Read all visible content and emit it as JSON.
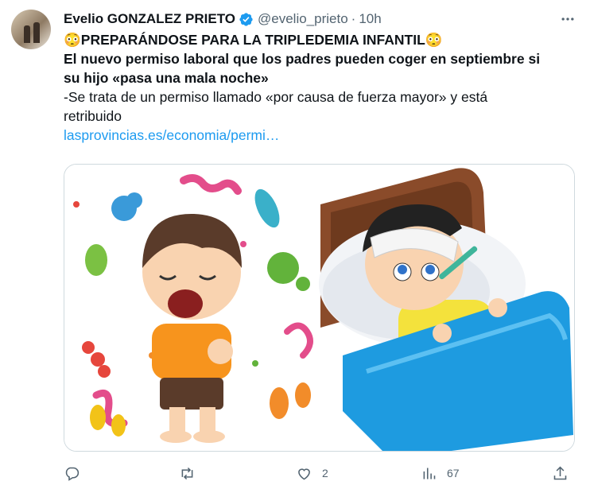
{
  "author": {
    "name": "Evelio GONZALEZ PRIETO",
    "handle": "@evelio_prieto",
    "time": "10h"
  },
  "tweet": {
    "headline": "😳PREPARÁNDOSE PARA LA TRIPLEDEMIA INFANTIL😳",
    "subhead_line1": "El nuevo permiso laboral que los padres pueden coger en septiembre si",
    "subhead_line2": "su hijo «pasa una mala noche»",
    "body_line1": "-Se trata de un permiso llamado «por causa de fuerza mayor» y está",
    "body_line2": "retribuido",
    "link": "lasprovincias.es/economia/permi…"
  },
  "metrics": {
    "replies": "",
    "reposts": "",
    "likes": "2",
    "views": "67"
  },
  "icons": {
    "verified": "verified-badge-icon",
    "more": "more-horizontal-icon",
    "reply": "reply-icon",
    "repost": "repost-icon",
    "like": "heart-icon",
    "views": "views-chart-icon",
    "share": "share-icon"
  },
  "colors": {
    "link": "#1d9bf0",
    "verified": "#1d9bf0",
    "muted": "#536471"
  }
}
